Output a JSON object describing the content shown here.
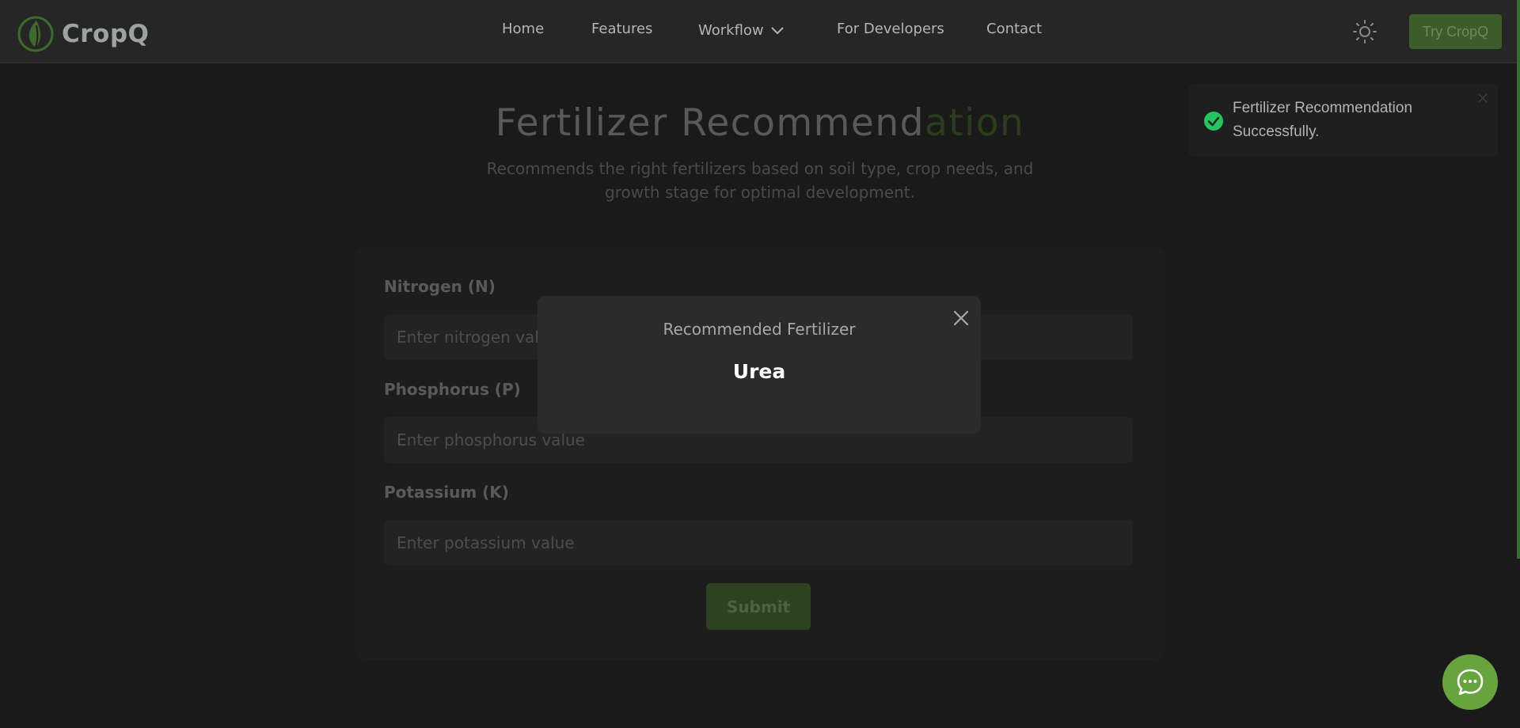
{
  "brand": {
    "name": "CropQ",
    "logo_icon": "leaf-icon",
    "accent_color": "#3c5c29"
  },
  "nav": {
    "links": [
      {
        "label": "Home"
      },
      {
        "label": "Features"
      },
      {
        "label": "Workflow"
      },
      {
        "label": "For Developers"
      },
      {
        "label": "Contact"
      }
    ],
    "theme_icon": "sun-icon",
    "cta_label": "Try CropQ"
  },
  "page": {
    "title_main": "Fertilizer Recommend",
    "title_accent": "ation",
    "subtitle": "Recommends the right fertilizers based on soil type, crop needs, and growth stage for optimal development."
  },
  "form": {
    "fields": [
      {
        "label": "Nitrogen (N)",
        "placeholder": "Enter nitrogen value"
      },
      {
        "label": "Phosphorus (P)",
        "placeholder": "Enter phosphorus value"
      },
      {
        "label": "Potassium (K)",
        "placeholder": "Enter potassium value"
      }
    ],
    "submit_label": "Submit"
  },
  "modal": {
    "heading": "Recommended Fertilizer",
    "result": "Urea"
  },
  "toast": {
    "message": "Fertilizer Recommendation Successfully.",
    "status_color": "#22c55e"
  },
  "chat": {
    "icon": "chat-bubble-icon",
    "color": "#67a43e"
  }
}
